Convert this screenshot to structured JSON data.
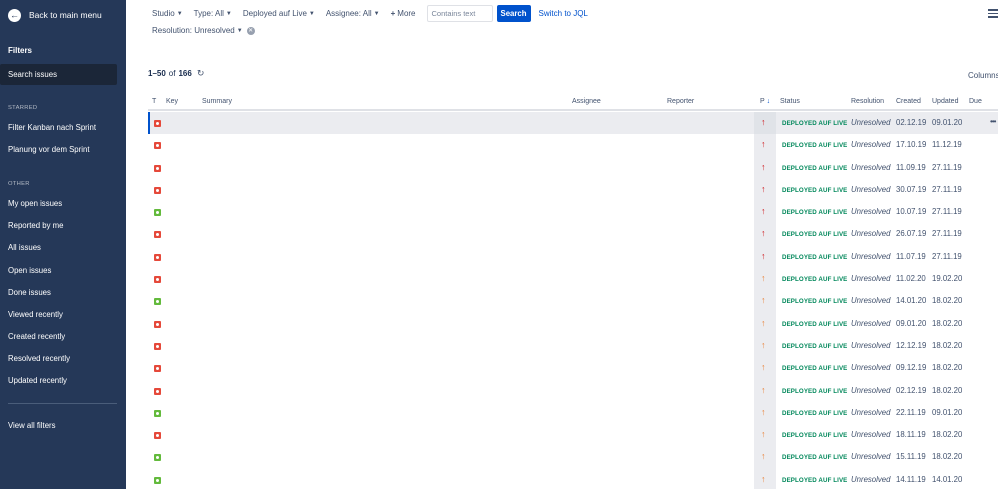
{
  "sidebar": {
    "back_label": "Back to main menu",
    "title": "Filters",
    "search_issues": "Search issues",
    "starred_heading": "STARRED",
    "starred": [
      "Filter Kanban nach Sprint",
      "Planung vor dem Sprint"
    ],
    "other_heading": "OTHER",
    "other": [
      "My open issues",
      "Reported by me",
      "All issues",
      "Open issues",
      "Done issues",
      "Viewed recently",
      "Created recently",
      "Resolved recently",
      "Updated recently"
    ],
    "view_all": "View all filters"
  },
  "toolbar": {
    "filters": [
      "Studio",
      "Type: All",
      "Deployed auf Live",
      "Assignee: All"
    ],
    "more_label": "More",
    "search_placeholder": "Contains text",
    "search_button": "Search",
    "jql_link": "Switch to JQL",
    "resolution": "Resolution: Unresolved"
  },
  "results": {
    "range": "1–50",
    "of": "of",
    "total": "166",
    "columns_label": "Columns"
  },
  "table": {
    "headers": {
      "t": "T",
      "key": "Key",
      "summary": "Summary",
      "assignee": "Assignee",
      "reporter": "Reporter",
      "p": "P",
      "status": "Status",
      "resolution": "Resolution",
      "created": "Created",
      "updated": "Updated",
      "due": "Due"
    },
    "rows": [
      {
        "type": "bug",
        "priority": "high",
        "status": "DEPLOYED AUF LIVE",
        "resolution": "Unresolved",
        "created": "02.12.19",
        "updated": "09.01.20"
      },
      {
        "type": "bug",
        "priority": "high",
        "status": "DEPLOYED AUF LIVE",
        "resolution": "Unresolved",
        "created": "17.10.19",
        "updated": "11.12.19"
      },
      {
        "type": "bug",
        "priority": "high",
        "status": "DEPLOYED AUF LIVE",
        "resolution": "Unresolved",
        "created": "11.09.19",
        "updated": "27.11.19"
      },
      {
        "type": "bug",
        "priority": "high",
        "status": "DEPLOYED AUF LIVE",
        "resolution": "Unresolved",
        "created": "30.07.19",
        "updated": "27.11.19"
      },
      {
        "type": "story",
        "priority": "high",
        "status": "DEPLOYED AUF LIVE",
        "resolution": "Unresolved",
        "created": "10.07.19",
        "updated": "27.11.19"
      },
      {
        "type": "bug",
        "priority": "high",
        "status": "DEPLOYED AUF LIVE",
        "resolution": "Unresolved",
        "created": "26.07.19",
        "updated": "27.11.19"
      },
      {
        "type": "bug",
        "priority": "high",
        "status": "DEPLOYED AUF LIVE",
        "resolution": "Unresolved",
        "created": "11.07.19",
        "updated": "27.11.19"
      },
      {
        "type": "bug",
        "priority": "med",
        "status": "DEPLOYED AUF LIVE",
        "resolution": "Unresolved",
        "created": "11.02.20",
        "updated": "19.02.20"
      },
      {
        "type": "story",
        "priority": "med",
        "status": "DEPLOYED AUF LIVE",
        "resolution": "Unresolved",
        "created": "14.01.20",
        "updated": "18.02.20"
      },
      {
        "type": "bug",
        "priority": "med",
        "status": "DEPLOYED AUF LIVE",
        "resolution": "Unresolved",
        "created": "09.01.20",
        "updated": "18.02.20"
      },
      {
        "type": "bug",
        "priority": "med",
        "status": "DEPLOYED AUF LIVE",
        "resolution": "Unresolved",
        "created": "12.12.19",
        "updated": "18.02.20"
      },
      {
        "type": "bug",
        "priority": "med",
        "status": "DEPLOYED AUF LIVE",
        "resolution": "Unresolved",
        "created": "09.12.19",
        "updated": "18.02.20"
      },
      {
        "type": "bug",
        "priority": "med",
        "status": "DEPLOYED AUF LIVE",
        "resolution": "Unresolved",
        "created": "02.12.19",
        "updated": "18.02.20"
      },
      {
        "type": "story",
        "priority": "med",
        "status": "DEPLOYED AUF LIVE",
        "resolution": "Unresolved",
        "created": "22.11.19",
        "updated": "09.01.20"
      },
      {
        "type": "bug",
        "priority": "med",
        "status": "DEPLOYED AUF LIVE",
        "resolution": "Unresolved",
        "created": "18.11.19",
        "updated": "18.02.20"
      },
      {
        "type": "story",
        "priority": "med",
        "status": "DEPLOYED AUF LIVE",
        "resolution": "Unresolved",
        "created": "15.11.19",
        "updated": "18.02.20"
      },
      {
        "type": "story",
        "priority": "med",
        "status": "DEPLOYED AUF LIVE",
        "resolution": "Unresolved",
        "created": "14.11.19",
        "updated": "14.01.20"
      }
    ]
  },
  "colors": {
    "sidebar_bg": "#253858",
    "accent": "#0052cc",
    "status_green": "#00875a",
    "bug_red": "#e5493a",
    "story_green": "#63ba3c",
    "priority_high": "#cd1317",
    "priority_medium": "#e97f33"
  }
}
